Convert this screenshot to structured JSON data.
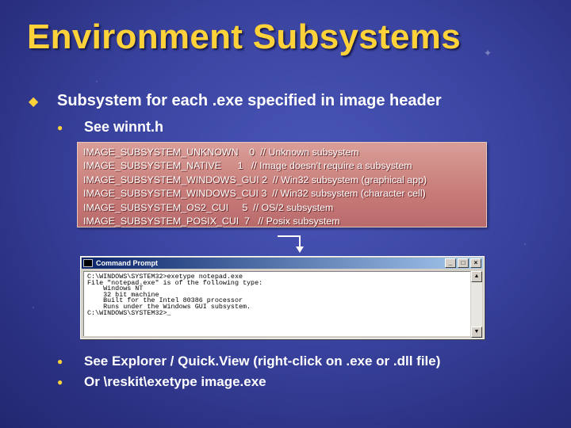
{
  "slide": {
    "title": "Environment Subsystems",
    "bullet1": "Subsystem for each .exe specified in image header",
    "bullet1_sub": "See winnt.h",
    "code_lines": [
      "IMAGE_SUBSYSTEM_UNKNOWN    0  // Unknown subsystem",
      "IMAGE_SUBSYSTEM_NATIVE      1   // Image doesn't require a subsystem",
      "IMAGE_SUBSYSTEM_WINDOWS_GUI 2  // Win32 subsystem (graphical app)",
      "IMAGE_SUBSYSTEM_WINDOWS_CUI 3  // Win32 subsystem (character cell)",
      "IMAGE_SUBSYSTEM_OS2_CUI     5  // OS/2 subsystem",
      "IMAGE_SUBSYSTEM_POSIX_CUI  7   // Posix subsystem"
    ],
    "bullet2": "See Explorer / Quick.View (right-click on .exe or .dll file)",
    "bullet3": "Or \\reskit\\exetype image.exe"
  },
  "window": {
    "title": "Command Prompt",
    "lines": [
      "C:\\WINDOWS\\SYSTEM32>exetype notepad.exe",
      "File \"notepad.exe\" is of the following type:",
      "    Windows NT",
      "    32 bit machine",
      "    Built for the Intel 80386 processor",
      "    Runs under the Windows GUI subsystem.",
      "",
      "C:\\WINDOWS\\SYSTEM32>_"
    ]
  },
  "icons": {
    "main_bullet": "diamond-bullet-icon",
    "sub_bullet": "round-bullet-icon",
    "arrow": "down-arrow-icon"
  },
  "colors": {
    "title": "#ffd23a",
    "background": "#3a44a0",
    "code_box": "#c77b78"
  }
}
